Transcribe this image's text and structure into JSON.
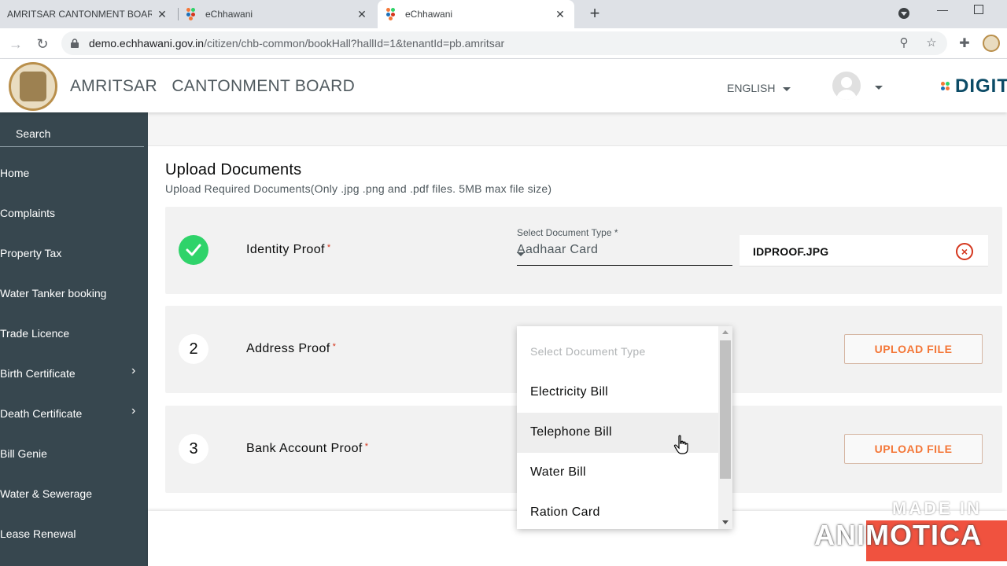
{
  "browser": {
    "tabs": [
      {
        "title": "AMRITSAR CANTONMENT BOAR"
      },
      {
        "title": "eChhawani"
      },
      {
        "title": "eChhawani"
      }
    ],
    "url_host": "demo.echhawani.gov.in",
    "url_path": "/citizen/chb-common/bookHall?hallId=1&tenantId=pb.amritsar"
  },
  "header": {
    "city_name": "AMRITSAR",
    "board_name": "CANTONMENT BOARD",
    "language": "ENGLISH",
    "brand": "DIGIT"
  },
  "sidebar": {
    "search_label": "Search",
    "items": [
      {
        "label": "Home"
      },
      {
        "label": "Complaints"
      },
      {
        "label": "Property Tax"
      },
      {
        "label": "Water Tanker booking"
      },
      {
        "label": "Trade Licence"
      },
      {
        "label": "Birth Certificate"
      },
      {
        "label": "Death Certificate"
      },
      {
        "label": "Bill Genie"
      },
      {
        "label": "Water & Sewerage"
      },
      {
        "label": "Lease Renewal"
      }
    ]
  },
  "main": {
    "title": "Upload Documents",
    "subtitle": "Upload Required Documents(Only .jpg .png and .pdf files. 5MB max file size)",
    "documents": [
      {
        "name": "Identity Proof",
        "required_mark": "*",
        "select_label": "Select Document Type *",
        "selected_type": "Aadhaar Card",
        "file_name": "IDPROOF.JPG"
      },
      {
        "step": "2",
        "name": "Address Proof",
        "required_mark": "*",
        "upload_label": "UPLOAD FILE"
      },
      {
        "step": "3",
        "name": "Bank Account Proof",
        "required_mark": "*",
        "upload_label": "UPLOAD FILE"
      }
    ]
  },
  "dropdown": {
    "placeholder": "Select Document Type",
    "options": [
      {
        "label": "Electricity Bill"
      },
      {
        "label": "Telephone Bill",
        "hovered": true
      },
      {
        "label": "Water Bill"
      },
      {
        "label": "Ration Card"
      }
    ]
  },
  "watermark": {
    "line1": "MADE IN",
    "line2": "ANIMOTICA"
  },
  "colors": {
    "sidebar_bg": "#37474f",
    "accent_orange": "#f47738",
    "success_green": "#2fd36a",
    "error_red": "#d4351c"
  }
}
